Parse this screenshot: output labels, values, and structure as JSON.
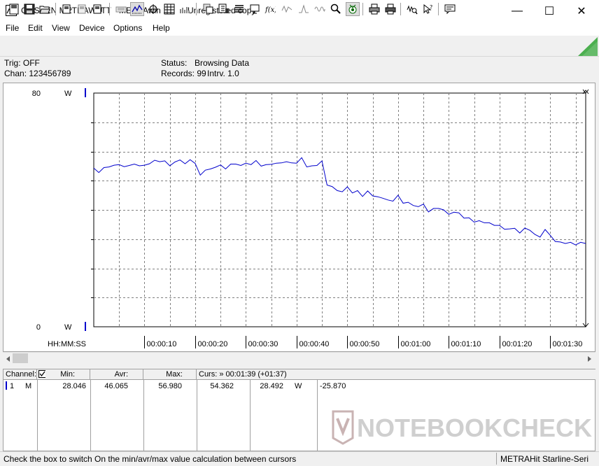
{
  "titlebar": {
    "vendor": "GOSSEN METRAWATT",
    "app": "METRAwin 10",
    "license": "Unregistered copy",
    "minimize": "—",
    "maximize": "☐",
    "close": "✕"
  },
  "menu": {
    "items": [
      {
        "label": "File"
      },
      {
        "label": "Edit"
      },
      {
        "label": "View"
      },
      {
        "label": "Device"
      },
      {
        "label": "Options"
      },
      {
        "label": "Help"
      }
    ]
  },
  "status": {
    "trig": "Trig: OFF",
    "chan": "Chan:  123456789",
    "status_label": "Status:",
    "status_value": "Browsing Data",
    "records_label": "Records: 99",
    "interval_label": "Intrv. 1.0"
  },
  "chart_data": {
    "type": "line",
    "ylim": [
      0,
      80
    ],
    "yticks": [
      {
        "value": 80,
        "label": "80",
        "unit": "W"
      },
      {
        "value": 0,
        "label": "0",
        "unit": "W"
      }
    ],
    "x_axis_label": "HH:MM:SS",
    "xlim": [
      0,
      97
    ],
    "xticks": [
      {
        "t": 10,
        "label": "00:00:10"
      },
      {
        "t": 20,
        "label": "00:00:20"
      },
      {
        "t": 30,
        "label": "00:00:30"
      },
      {
        "t": 40,
        "label": "00:00:40"
      },
      {
        "t": 50,
        "label": "00:00:50"
      },
      {
        "t": 60,
        "label": "00:01:00"
      },
      {
        "t": 70,
        "label": "00:01:10"
      },
      {
        "t": 80,
        "label": "00:01:20"
      },
      {
        "t": 90,
        "label": "00:01:30"
      }
    ],
    "line_color": "#0000cc",
    "grid": true,
    "series": [
      {
        "x": [
          0,
          1,
          2,
          3,
          4,
          5,
          6,
          7,
          8,
          9,
          10,
          11,
          12,
          13,
          14,
          15,
          16,
          17,
          18,
          19,
          20,
          21,
          22,
          23,
          24,
          25,
          26,
          27,
          28,
          29,
          30,
          31,
          32,
          33,
          34,
          35,
          36,
          37,
          38,
          39,
          40,
          41,
          42,
          43,
          44,
          45,
          46,
          47,
          48,
          49,
          50,
          51,
          52,
          53,
          54,
          55,
          56,
          57,
          58,
          59,
          60,
          61,
          62,
          63,
          64,
          65,
          66,
          67,
          68,
          69,
          70,
          71,
          72,
          73,
          74,
          75,
          76,
          77,
          78,
          79,
          80,
          81,
          82,
          83,
          84,
          85,
          86,
          87,
          88,
          89,
          90,
          91,
          92,
          93,
          94,
          95,
          96,
          97
        ],
        "y": [
          54.3,
          52.8,
          54.5,
          54.7,
          55.3,
          55.5,
          54.8,
          55.2,
          55.7,
          55.1,
          55.3,
          55.8,
          57.0,
          56.5,
          56.8,
          55.1,
          56.4,
          57.1,
          55.8,
          57.2,
          55.9,
          51.9,
          53.6,
          54.0,
          54.6,
          55.4,
          54.0,
          55.7,
          55.7,
          55.2,
          56.0,
          55.5,
          56.9,
          55.0,
          55.5,
          55.6,
          56.0,
          56.1,
          56.5,
          56.1,
          56.0,
          57.9,
          54.7,
          55.1,
          55.2,
          56.8,
          48.5,
          48.0,
          46.6,
          46.2,
          47.9,
          45.8,
          46.6,
          44.6,
          46.5,
          44.8,
          44.5,
          44.0,
          43.4,
          43.0,
          45.0,
          42.3,
          42.6,
          41.5,
          41.1,
          42.0,
          39.3,
          40.5,
          40.5,
          40.0,
          38.5,
          39.2,
          39.0,
          37.2,
          37.3,
          35.8,
          36.3,
          35.6,
          35.6,
          34.7,
          34.7,
          33.4,
          33.5,
          33.7,
          32.1,
          33.8,
          33.0,
          31.6,
          30.7,
          33.3,
          31.3,
          29.2,
          29.0,
          28.5,
          28.9,
          28.0,
          28.9,
          28.5
        ]
      }
    ]
  },
  "table": {
    "headers": {
      "channel": "Channel:",
      "min": "Min:",
      "avr": "Avr:",
      "max": "Max:",
      "curs": "Curs: » 00:01:39 (+01:37)"
    },
    "row": {
      "channel_no": "1",
      "mode": "M",
      "min": "28.046",
      "avr": "46.065",
      "max": "56.980",
      "c1": "54.362",
      "c2": "28.492",
      "unit": "W",
      "delta": "-25.870"
    }
  },
  "statusbar": {
    "hint": "Check the box to switch On the min/avr/max value calculation between cursors",
    "device": "METRAHit Starline-Seri"
  },
  "watermark": {
    "text": "NOTEBOOKCHECK"
  }
}
